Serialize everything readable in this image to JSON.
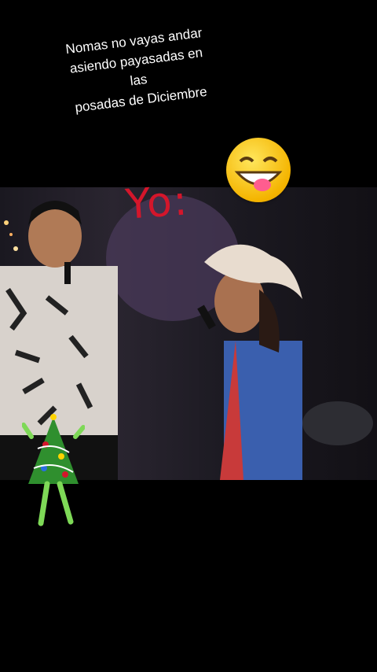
{
  "caption": {
    "lines": [
      "Nomas no vayas andar",
      "asiendo payasadas en",
      "las",
      "posadas de Diciembre"
    ]
  },
  "overlay": {
    "yo_label": "Yo:"
  },
  "icons": {
    "emoji": "grinning-squinting-tongue-emoji",
    "sticker": "dancing-christmas-tree-sticker"
  },
  "colors": {
    "background": "#000000",
    "yo_text": "#d4162b",
    "caption_text": "#ffffff"
  }
}
